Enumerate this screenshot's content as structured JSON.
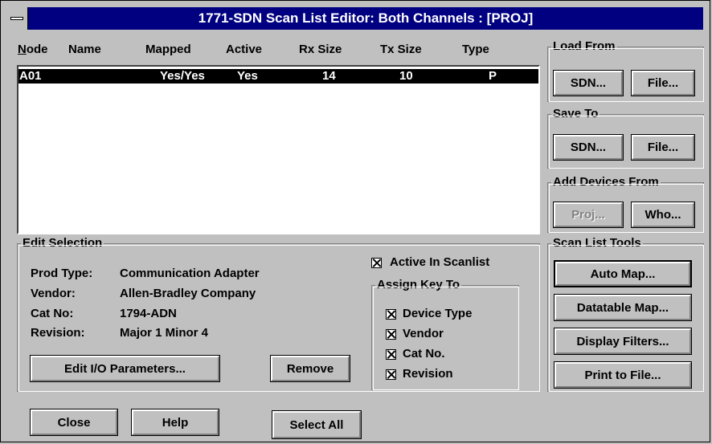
{
  "window": {
    "title": "1771-SDN Scan List Editor: Both Channels : [PROJ]"
  },
  "columns": [
    "Node",
    "Name",
    "Mapped",
    "Active",
    "Rx Size",
    "Tx Size",
    "Type"
  ],
  "rows": [
    {
      "node": "A01",
      "name": "",
      "mapped": "Yes/Yes",
      "active": "Yes",
      "rx": "14",
      "tx": "10",
      "type": "P"
    }
  ],
  "load_from": {
    "label": "Load From",
    "sdn": "SDN...",
    "file": "File..."
  },
  "save_to": {
    "label": "Save To",
    "sdn": "SDN...",
    "file": "File..."
  },
  "add_devices": {
    "label": "Add Devices From",
    "proj": "Proj...",
    "who": "Who..."
  },
  "tools": {
    "label": "Scan List Tools",
    "auto_map": "Auto Map...",
    "datatable_map": "Datatable Map...",
    "display_filters": "Display Filters...",
    "print": "Print to File..."
  },
  "edit_selection": {
    "label": "Edit Selection",
    "prod_type_label": "Prod Type:",
    "prod_type": "Communication Adapter",
    "vendor_label": "Vendor:",
    "vendor": "Allen-Bradley Company",
    "catno_label": "Cat No:",
    "catno": "1794-ADN",
    "revision_label": "Revision:",
    "revision": "Major 1 Minor 4",
    "edit_io": "Edit I/O Parameters...",
    "remove": "Remove",
    "active_in_scanlist": "Active In Scanlist",
    "assign_key": "Assign Key To",
    "device_type": "Device Type",
    "vendor_cb": "Vendor",
    "catno_cb": "Cat No.",
    "revision_cb": "Revision"
  },
  "bottom": {
    "close": "Close",
    "help": "Help",
    "select_all": "Select All"
  }
}
